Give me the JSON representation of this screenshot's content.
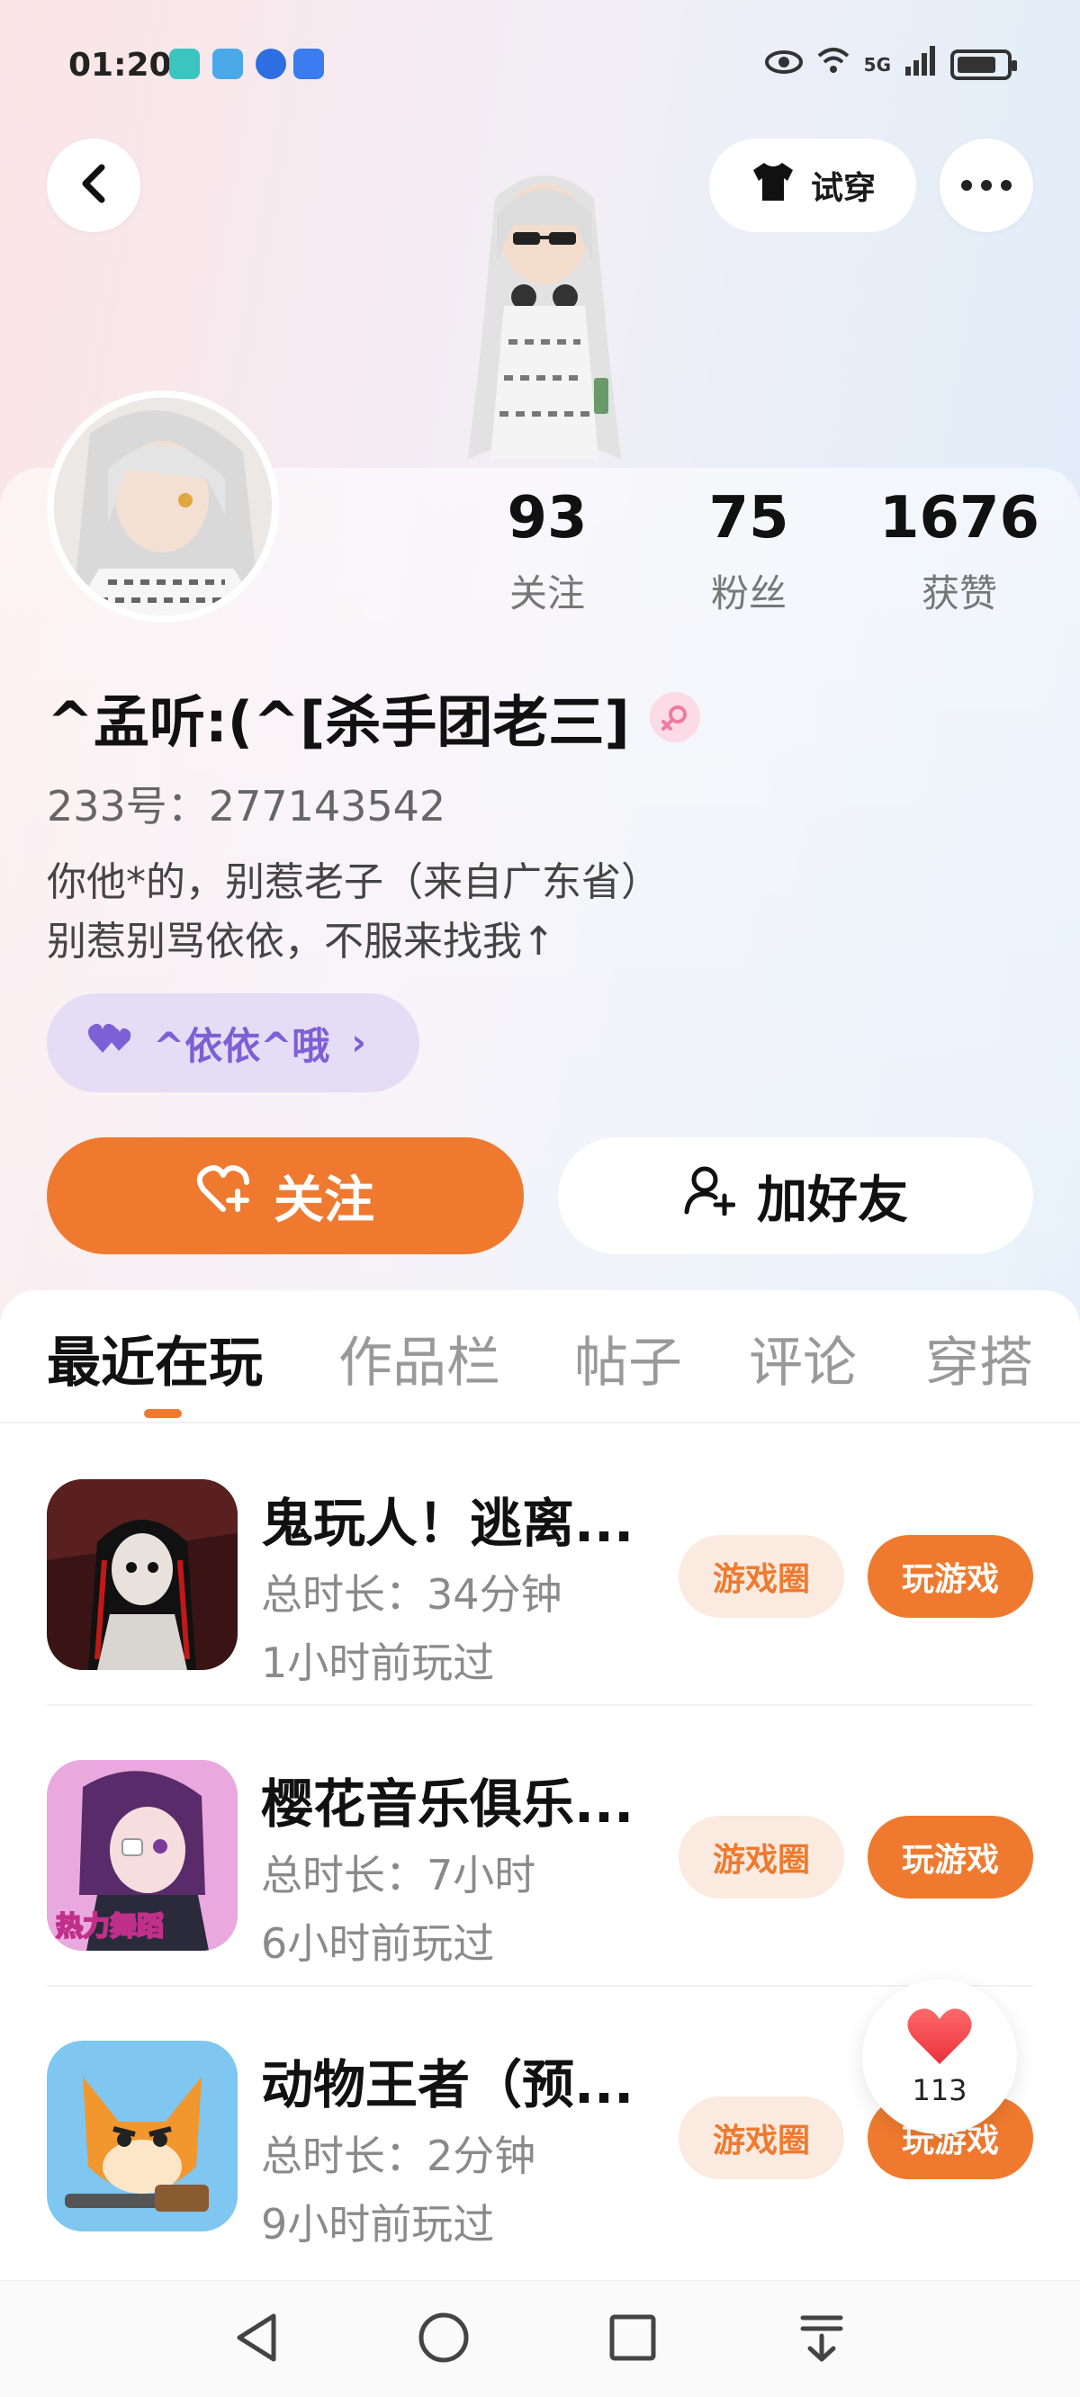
{
  "status_bar": {
    "time": "01:20",
    "network": "5G",
    "icons": [
      "home-app-icon",
      "book-app-icon",
      "browser-app-icon",
      "shop-app-icon",
      "eye-icon",
      "wifi-icon",
      "signal-icon",
      "battery-icon"
    ]
  },
  "header": {
    "back_icon": "chevron-left-icon",
    "try_on_label": "试穿",
    "more_icon": "more-dots-icon"
  },
  "profile": {
    "stats": [
      {
        "value": "93",
        "label": "关注"
      },
      {
        "value": "75",
        "label": "粉丝"
      },
      {
        "value": "1676",
        "label": "获赞"
      }
    ],
    "username": "^孟听:(^[杀手团老三]",
    "gender_icon": "female-icon",
    "id_line": "233号：277143542",
    "bio_line1": "你他*的，别惹老子（来自广东省）",
    "bio_line2": "别惹别骂依依，不服来找我↑",
    "relation_tag": "^依依^哦"
  },
  "actions": {
    "follow_label": "关注",
    "add_friend_label": "加好友"
  },
  "tabs": [
    {
      "label": "最近在玩",
      "active": true
    },
    {
      "label": "作品栏",
      "active": false
    },
    {
      "label": "帖子",
      "active": false
    },
    {
      "label": "评论",
      "active": false
    },
    {
      "label": "穿搭",
      "active": false
    }
  ],
  "games": [
    {
      "title": "鬼玩人！逃离...",
      "duration": "总时长：34分钟",
      "last_played": "1小时前玩过",
      "circle_label": "游戏圈",
      "play_label": "玩游戏"
    },
    {
      "title": "樱花音乐俱乐...",
      "duration": "总时长：7小时",
      "last_played": "6小时前玩过",
      "circle_label": "游戏圈",
      "play_label": "玩游戏",
      "thumb_text": "热力舞蹈"
    },
    {
      "title": "动物王者（预...",
      "duration": "总时长：2分钟",
      "last_played": "9小时前玩过",
      "circle_label": "游戏圈",
      "play_label": "玩游戏"
    }
  ],
  "floating_like": {
    "count": "113"
  },
  "colors": {
    "accent": "#ef7a2f",
    "tag_purple": "#7b60d6"
  }
}
